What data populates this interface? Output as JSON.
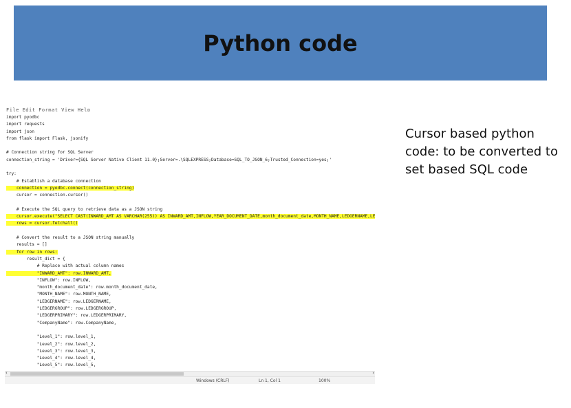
{
  "slide": {
    "title": "Python code",
    "caption": "Cursor based python code: to be converted to set based  SQL code"
  },
  "editor": {
    "menu_items": "File  Edit  Format  View  Help",
    "code_lines": [
      {
        "text": "import pyodbc",
        "highlight": false
      },
      {
        "text": "import requests",
        "highlight": false
      },
      {
        "text": "import json",
        "highlight": false
      },
      {
        "text": "from flask import Flask, jsonify",
        "highlight": false
      },
      {
        "text": "",
        "highlight": false
      },
      {
        "text": "# Connection string for SQL Server",
        "highlight": false
      },
      {
        "text": "connection_string = 'Driver={SQL Server Native Client 11.0};Server=.\\SQLEXPRESS;Database=SQL_TO_JSON_6;Trusted_Connection=yes;'",
        "highlight": false
      },
      {
        "text": "",
        "highlight": false
      },
      {
        "text": "try:",
        "highlight": false
      },
      {
        "text": "    # Establish a database connection",
        "highlight": false
      },
      {
        "text": "    connection = pyodbc.connect(connection_string)",
        "highlight": true
      },
      {
        "text": "    cursor = connection.cursor()",
        "highlight": false
      },
      {
        "text": "",
        "highlight": false
      },
      {
        "text": "    # Execute the SQL query to retrieve data as a JSON string",
        "highlight": false
      },
      {
        "text": "    cursor.execute(\"SELECT CAST(INWARD_AMT AS VARCHAR(255)) AS INWARD_AMT,INFLOW,YEAR_DOCUMENT_DATE,month_document_date,MONTH_NAME,LEDGERNAME,LEDGERGROUP,LEDGERPRIMARY",
        "highlight": true
      },
      {
        "text": "    rows = cursor.fetchall()",
        "highlight": true
      },
      {
        "text": "",
        "highlight": false
      },
      {
        "text": "    # Convert the result to a JSON string manually",
        "highlight": false
      },
      {
        "text": "    results = []",
        "highlight": false
      },
      {
        "text": "    for row in rows:",
        "highlight": true
      },
      {
        "text": "        result_dict = {",
        "highlight": false
      },
      {
        "text": "            # Replace with actual column names",
        "highlight": false
      },
      {
        "text": "            \"INWARD_AMT\": row.INWARD_AMT,",
        "highlight": true
      },
      {
        "text": "            \"INFLOW\": row.INFLOW,",
        "highlight": false
      },
      {
        "text": "            \"month_document_date\": row.month_document_date,",
        "highlight": false
      },
      {
        "text": "            \"MONTH_NAME\": row.MONTH_NAME,",
        "highlight": false
      },
      {
        "text": "            \"LEDGERNAME\": row.LEDGERNAME,",
        "highlight": false
      },
      {
        "text": "            \"LEDGERGROUP\": row.LEDGERGROUP,",
        "highlight": false
      },
      {
        "text": "            \"LEDGERPRIMARY\": row.LEDGERPRIMARY,",
        "highlight": false
      },
      {
        "text": "            \"CompanyName\": row.CompanyName,",
        "highlight": false
      },
      {
        "text": "",
        "highlight": false
      },
      {
        "text": "            \"Level_1\": row.level_1,",
        "highlight": false
      },
      {
        "text": "            \"Level_2\": row.level_2,",
        "highlight": false
      },
      {
        "text": "            \"Level_3\": row.level_3,",
        "highlight": false
      },
      {
        "text": "            \"Level_4\": row.level_4,",
        "highlight": false
      },
      {
        "text": "            \"Level_5\": row.level_5,",
        "highlight": false
      }
    ],
    "status": {
      "line_ending": "Windows (CRLF)",
      "position": "Ln 1, Col 1",
      "zoom": "100%"
    }
  },
  "colors": {
    "banner": "#4f81bd",
    "highlight": "#ffff33"
  }
}
